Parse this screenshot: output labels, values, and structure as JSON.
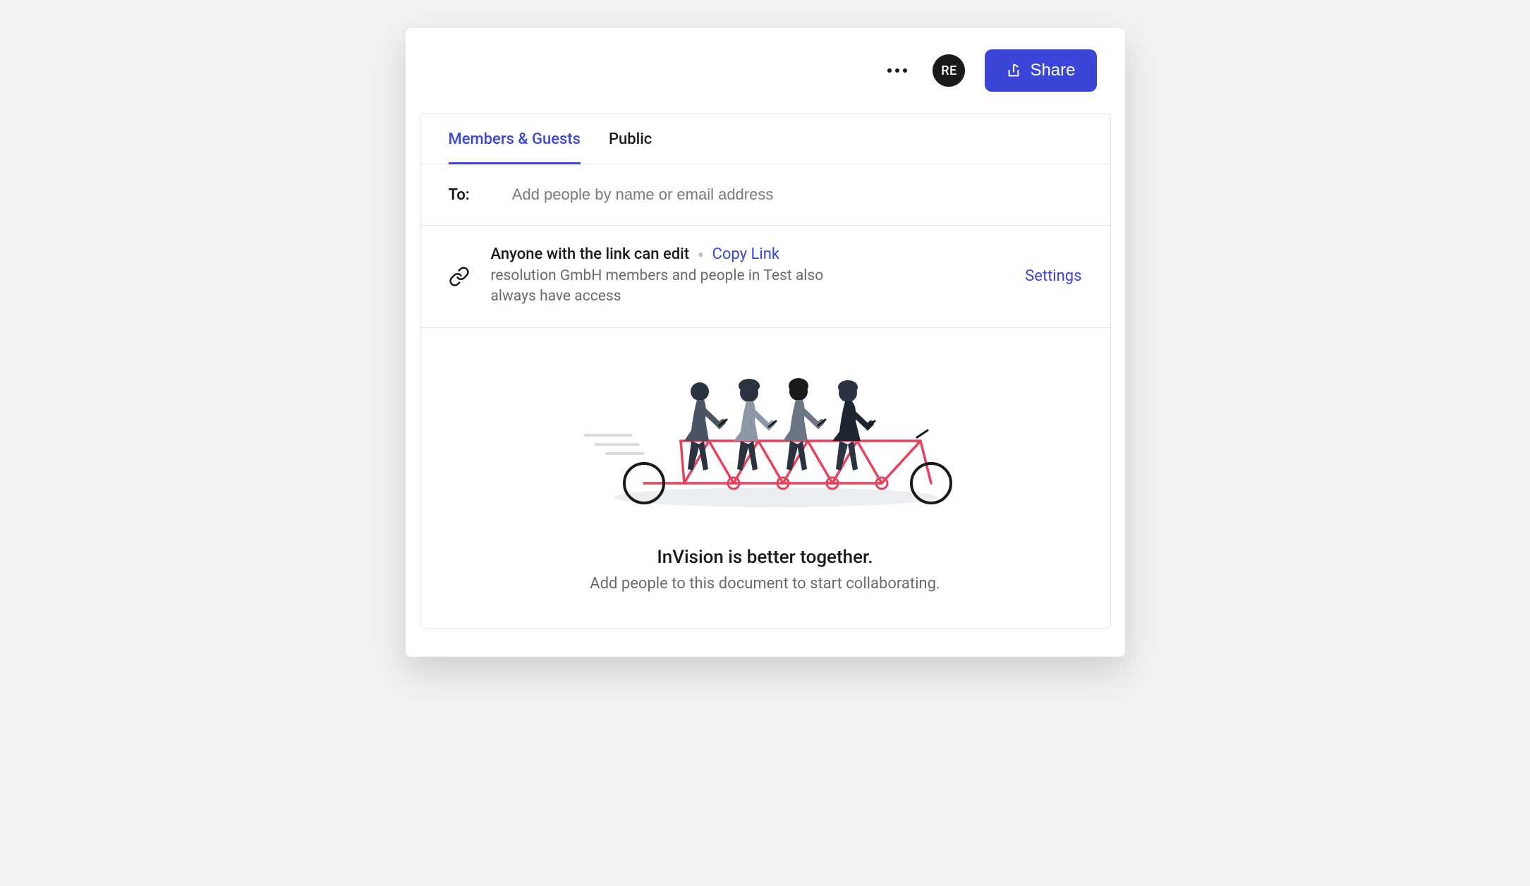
{
  "header": {
    "avatar_initials": "RE",
    "share_label": "Share"
  },
  "tabs": {
    "members_guests": "Members & Guests",
    "public": "Public"
  },
  "to_section": {
    "label": "To:",
    "placeholder": "Add people by name or email address"
  },
  "link_section": {
    "title": "Anyone with the link can edit",
    "copy_link": "Copy Link",
    "subtitle": "resolution GmbH members and people in Test also always have access",
    "settings": "Settings"
  },
  "empty_state": {
    "title": "InVision is better together.",
    "subtitle": "Add people to this document to start collaborating."
  }
}
